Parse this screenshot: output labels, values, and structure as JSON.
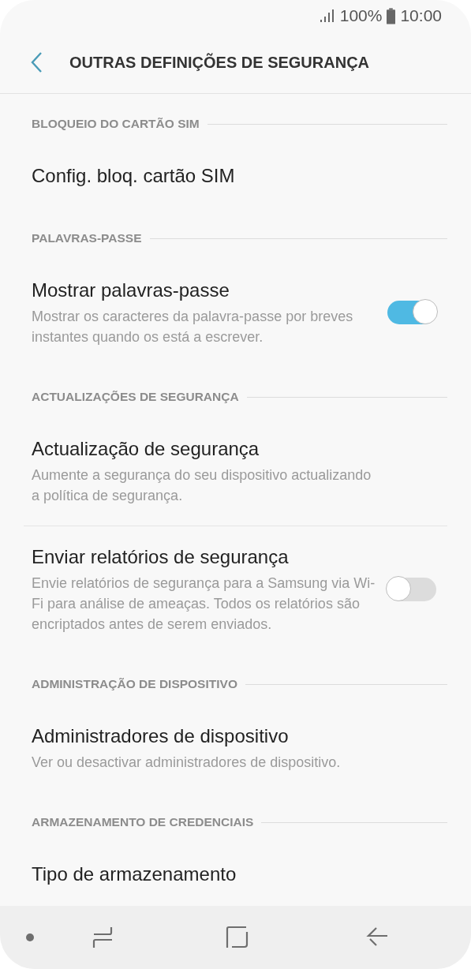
{
  "status_bar": {
    "battery": "100%",
    "time": "10:00"
  },
  "header": {
    "title": "OUTRAS DEFINIÇÕES DE SEGURANÇA"
  },
  "sections": [
    {
      "heading": "BLOQUEIO DO CARTÃO SIM",
      "items": [
        {
          "kind": "link",
          "title": "Config. bloq. cartão SIM"
        }
      ]
    },
    {
      "heading": "PALAVRAS-PASSE",
      "items": [
        {
          "kind": "toggle",
          "title": "Mostrar palavras-passe",
          "subtitle": "Mostrar os caracteres da palavra-passe por breves instantes quando os está a escrever.",
          "on": true
        }
      ]
    },
    {
      "heading": "ACTUALIZAÇÕES DE SEGURANÇA",
      "items": [
        {
          "kind": "link",
          "title": "Actualização de segurança",
          "subtitle": "Aumente a segurança do seu dispositivo actualizando a política de segurança."
        },
        {
          "kind": "toggle",
          "title": "Enviar relatórios de segurança",
          "subtitle": "Envie relatórios de segurança para a Samsung via Wi-Fi para análise de ameaças. Todos os relatórios são encriptados antes de serem enviados.",
          "on": false
        }
      ]
    },
    {
      "heading": "ADMINISTRAÇÃO DE DISPOSITIVO",
      "items": [
        {
          "kind": "link",
          "title": "Administradores de dispositivo",
          "subtitle": "Ver ou desactivar administradores de dispositivo."
        }
      ]
    },
    {
      "heading": "ARMAZENAMENTO DE CREDENCIAIS",
      "items": [
        {
          "kind": "link",
          "title": "Tipo de armazenamento"
        }
      ]
    }
  ]
}
